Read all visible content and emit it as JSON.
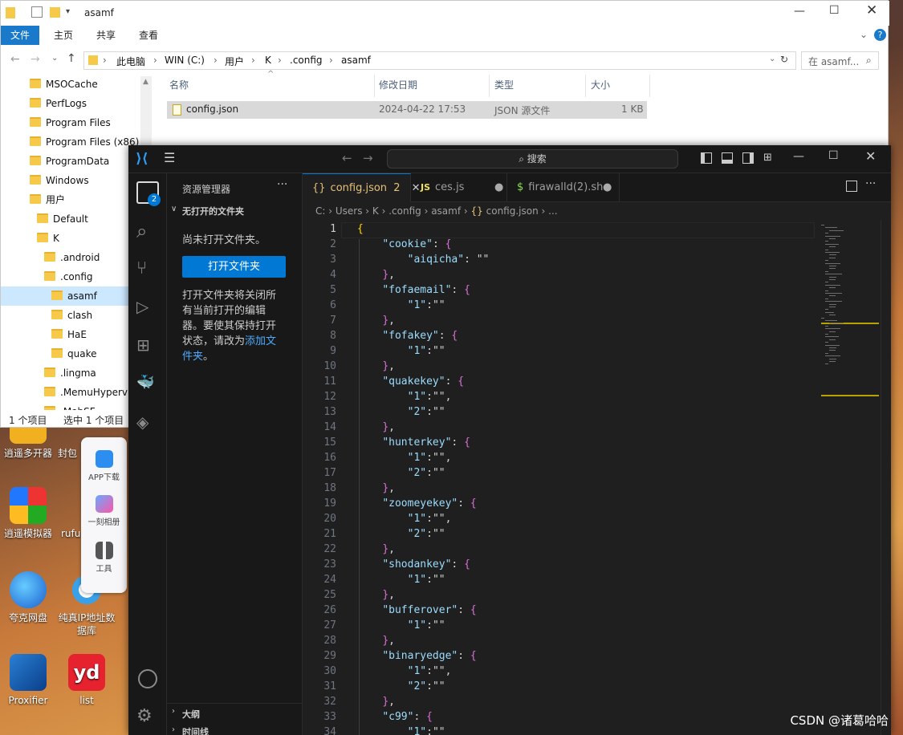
{
  "explorer": {
    "title": "asamf",
    "ribbon_tabs": [
      "文件",
      "主页",
      "共享",
      "查看"
    ],
    "breadcrumbs": [
      "此电脑",
      "WIN (C:)",
      "用户",
      "K",
      ".config",
      "asamf"
    ],
    "search_placeholder": "在 asamf...",
    "nav_items": [
      {
        "label": "MSOCache",
        "indent": 0
      },
      {
        "label": "PerfLogs",
        "indent": 0
      },
      {
        "label": "Program Files",
        "indent": 0
      },
      {
        "label": "Program Files (x86)",
        "indent": 0
      },
      {
        "label": "ProgramData",
        "indent": 0
      },
      {
        "label": "Windows",
        "indent": 0
      },
      {
        "label": "用户",
        "indent": 0
      },
      {
        "label": "Default",
        "indent": 1
      },
      {
        "label": "K",
        "indent": 1
      },
      {
        "label": ".android",
        "indent": 2
      },
      {
        "label": ".config",
        "indent": 2
      },
      {
        "label": "asamf",
        "indent": 3,
        "selected": true
      },
      {
        "label": "clash",
        "indent": 3
      },
      {
        "label": "HaE",
        "indent": 3
      },
      {
        "label": "quake",
        "indent": 3
      },
      {
        "label": ".lingma",
        "indent": 2
      },
      {
        "label": ".MemuHyperv",
        "indent": 2
      },
      {
        "label": ".MobSF",
        "indent": 2
      }
    ],
    "columns": [
      "名称",
      "修改日期",
      "类型",
      "大小"
    ],
    "files": [
      {
        "name": "config.json",
        "date": "2024-04-22 17:53",
        "type": "JSON 源文件",
        "size": "1 KB"
      }
    ],
    "status_count": "1 个项目",
    "status_selected": "选中 1 个项目"
  },
  "desktop": {
    "icons": [
      {
        "label": "逍遥多开器"
      },
      {
        "label": "封包"
      },
      {
        "label": "逍遥模拟器"
      },
      {
        "label": "rufu"
      },
      {
        "label": "夸克网盘"
      },
      {
        "label": "纯真IP地址数据库"
      },
      {
        "label": "Proxifier"
      },
      {
        "label": "list"
      }
    ],
    "toolbar": [
      "APP下载",
      "一刻相册",
      "工具"
    ]
  },
  "vscode": {
    "search_label": "搜索",
    "sidebar_title": "资源管理器",
    "section_title": "无打开的文件夹",
    "no_folder_text": "尚未打开文件夹。",
    "open_folder_button": "打开文件夹",
    "help_text": "打开文件夹将关闭所有当前打开的编辑器。要使其保持打开状态，请改为",
    "help_link": "添加文件夹",
    "help_end": "。",
    "outline": "大纲",
    "timeline": "时间线",
    "explorer_badge": "2",
    "tabs": [
      {
        "label": "config.json",
        "badge": "2",
        "icon": "{}"
      },
      {
        "label": "ces.js",
        "icon": "JS"
      },
      {
        "label": "firawalld(2).sh",
        "icon": "$"
      }
    ],
    "breadcrumbs": [
      "C:",
      "Users",
      "K",
      ".config",
      "asamf",
      "config.json",
      "..."
    ],
    "code_lines": [
      "{",
      "    \"cookie\": {",
      "        \"aiqicha\": \"\"",
      "    },",
      "    \"fofaemail\": {",
      "        \"1\":\"\"",
      "    },",
      "    \"fofakey\": {",
      "        \"1\":\"\"",
      "    },",
      "    \"quakekey\": {",
      "        \"1\":\"\",",
      "        \"2\":\"\"",
      "    },",
      "    \"hunterkey\": {",
      "        \"1\":\"\",",
      "        \"2\":\"\"",
      "    },",
      "    \"zoomeyekey\": {",
      "        \"1\":\"\",",
      "        \"2\":\"\"",
      "    },",
      "    \"shodankey\": {",
      "        \"1\":\"\"",
      "    },",
      "    \"bufferover\": {",
      "        \"1\":\"\"",
      "    },",
      "    \"binaryedge\": {",
      "        \"1\":\"\",",
      "        \"2\":\"\"",
      "    },",
      "    \"c99\": {",
      "        \"1\":\"\""
    ]
  },
  "watermark": "CSDN @诸葛哈哈"
}
